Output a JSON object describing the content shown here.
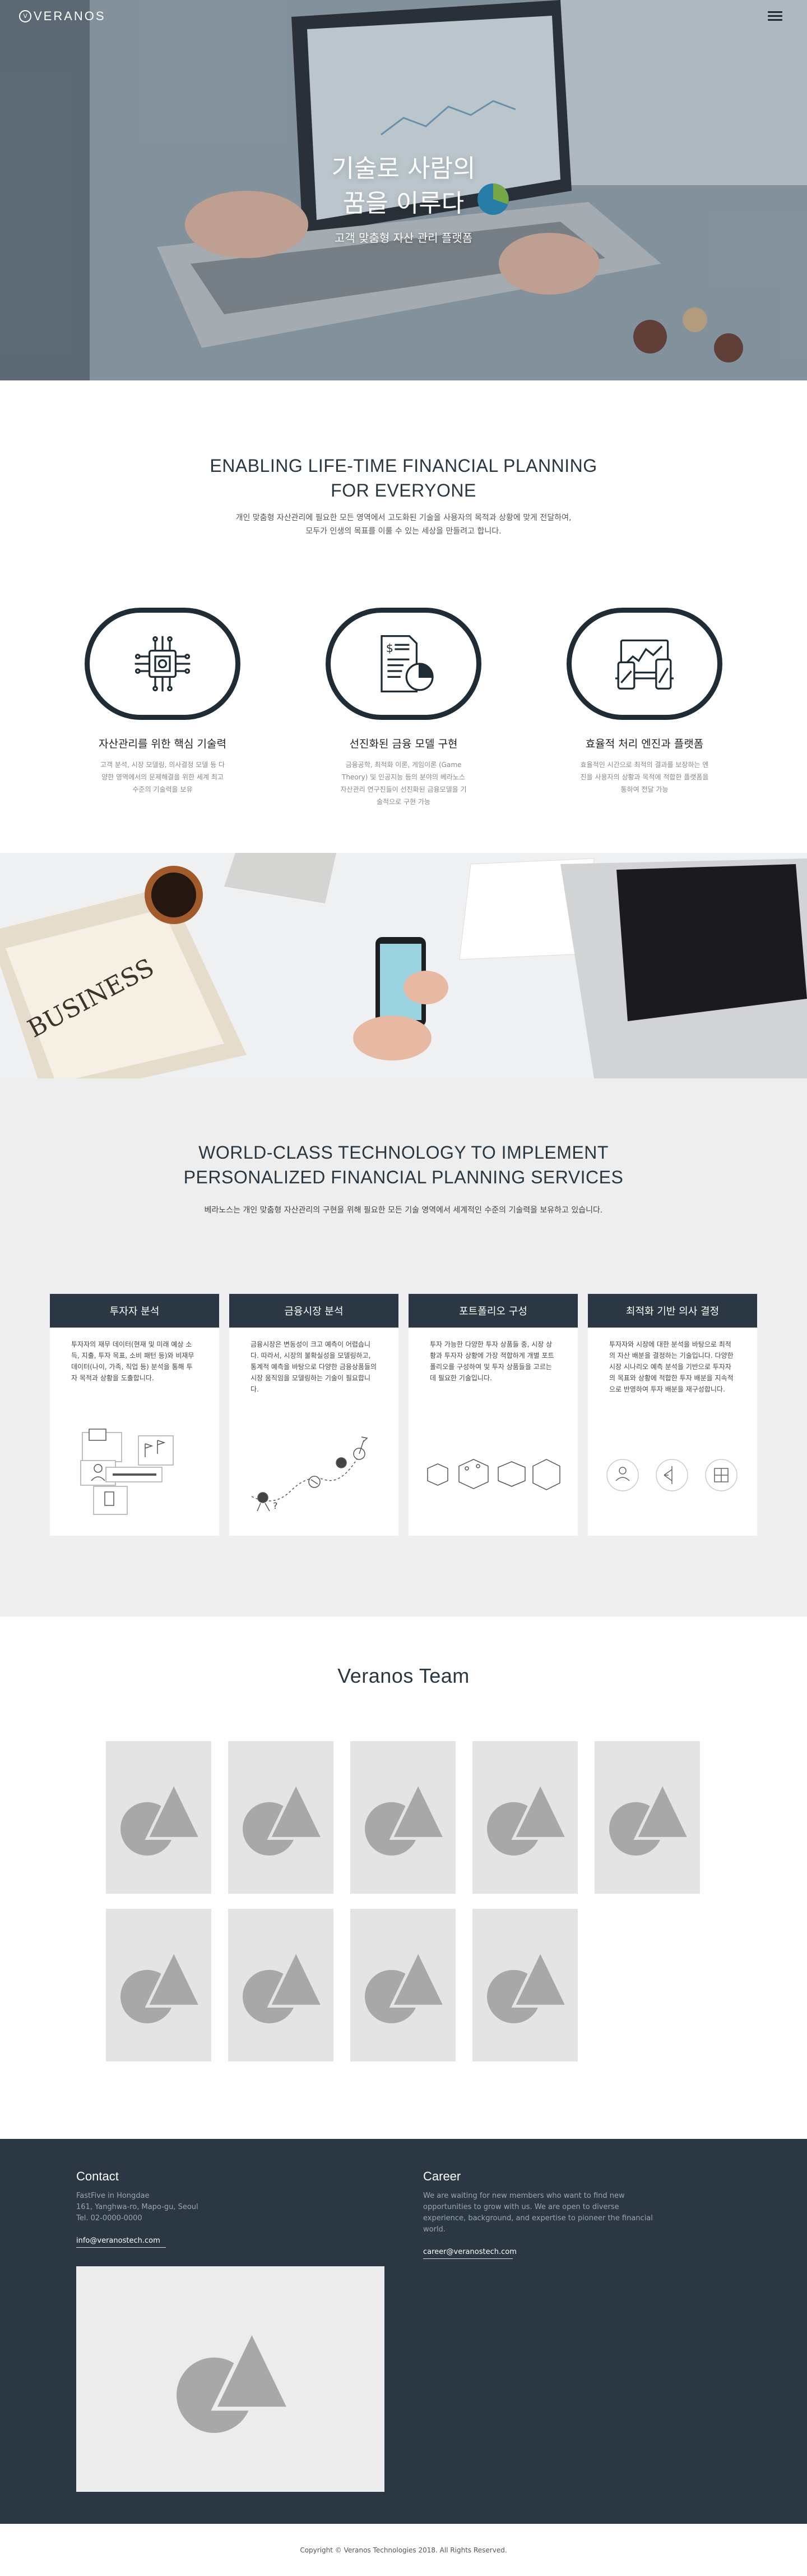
{
  "brand": {
    "logo_mark": "V",
    "logo_text": "VERANOS"
  },
  "hero": {
    "title_line1": "기술로 사람의",
    "title_line2": "꿈을 이루다",
    "subtitle": "고객 맞춤형 자산 관리 플랫폼"
  },
  "plan": {
    "title_line1": "ENABLING LIFE-TIME FINANCIAL PLANNING",
    "title_line2": "FOR EVERYONE",
    "desc_line1": "개인 맞춤형 자산관리에 필요한 모든 영역에서 고도화된 기술을 사용자의 목적과 상황에 맞게 전달하여,",
    "desc_line2": "모두가 인생의 목표를 이룰 수 있는 세상을 만들려고 합니다.",
    "features": [
      {
        "icon": "chip-icon",
        "title": "자산관리를 위한 핵심 기술력",
        "desc": "고객 분석, 시장 모델링, 의사결정 모델 등 다양한 영역에서의 문제해결을 위한 세계 최고 수준의 기술력을 보유"
      },
      {
        "icon": "document-chart-icon",
        "title": "선진화된 금융 모델 구현",
        "desc": "금융공학, 최적화 이론, 게임이론 (Game Theory) 및 인공지능 등의 분야의 베라노스 자산관리 연구진들이 선진화된 금융모델을 기술적으로 구현 가능"
      },
      {
        "icon": "devices-icon",
        "title": "효율적 처리 엔진과 플랫폼",
        "desc": "효율적인 시간으로 최적의 결과를 보장하는 엔진을 사용자의 상황과 목적에 적합한 플랫폼을 통하여 전달 가능"
      }
    ]
  },
  "tech": {
    "title_line1": "WORLD-CLASS TECHNOLOGY TO IMPLEMENT",
    "title_line2": "PERSONALIZED FINANCIAL PLANNING SERVICES",
    "desc": "베라노스는 개인 맞춤형 자산관리의 구현을 위해 필요한 모든 기술 영역에서 세계적인 수준의 기술력을 보유하고 있습니다.",
    "cards": [
      {
        "title": "투자자 분석",
        "desc": "투자자의 재무 데이터(현재 및 미래 예상 소득, 지출, 투자 목표, 소비 패턴 등)와 비재무 데이터(나이, 가족, 직업 등) 분석을 통해 투자 목적과 상황을 도출합니다."
      },
      {
        "title": "금융시장 분석",
        "desc": "금융시장은 변동성이 크고 예측이 어렵습니다. 따라서, 시장의 불확실성을 모델링하고, 통계적 예측을 바탕으로 다양한 금융상품들의 시장 움직임을 모델링하는 기술이 필요합니다."
      },
      {
        "title": "포트폴리오 구성",
        "desc": "투자 가능한 다양한 투자 상품들 중, 시장 상황과 투자자 상황에 가장 적합하게 개별 포트폴리오를 구성하여 및 투자 상품들을 고르는데 필요한 기술입니다."
      },
      {
        "title": "최적화 기반 의사 결정",
        "desc": "투자자와 시장에 대한 분석을 바탕으로 최적의 자산 배분을 결정하는 기술입니다. 다양한 시장 시나리오 예측 분석을 기반으로 투자자의 목표와 상황에 적합한 투자 배분을 지속적으로 반영하여 투자 배분을 재구성합니다."
      }
    ]
  },
  "team": {
    "title": "Veranos Team"
  },
  "footer": {
    "contact_title": "Contact",
    "address_line1": "FastFive in Hongdae",
    "address_line2": "161, Yanghwa-ro, Mapo-gu, Seoul",
    "tel": "Tel. 02-0000-0000",
    "contact_email": "info@veranostech.com",
    "career_title": "Career",
    "career_desc": "We are waiting for new members who want to find new opportunities to grow with us. We are open to diverse experience, background, and expertise to pioneer the financial world.",
    "career_email": "career@veranostech.com",
    "copyright": "Copyright © Veranos Technologies 2018. All Rights Reserved."
  }
}
